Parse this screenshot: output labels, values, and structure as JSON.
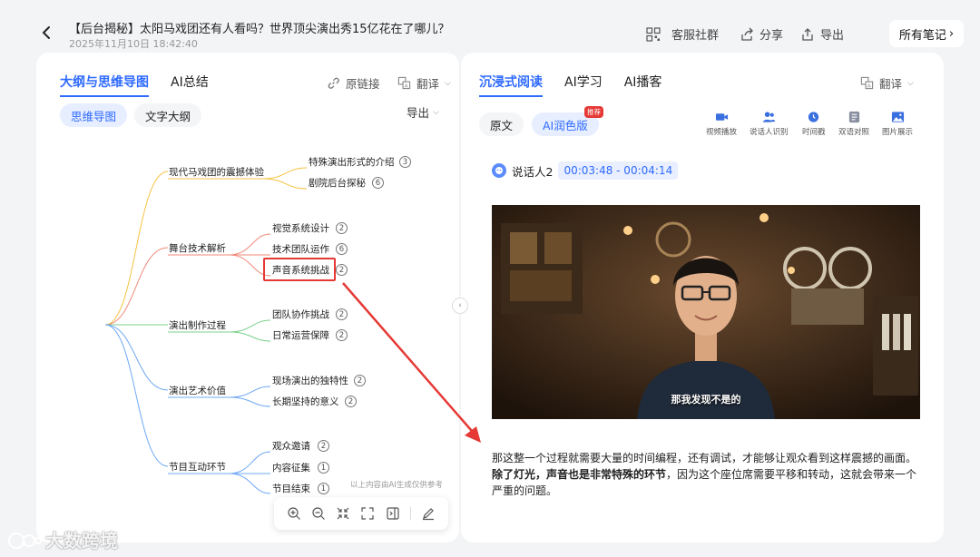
{
  "header": {
    "title": "【后台揭秘】太阳马戏团还有人看吗？世界顶尖演出秀15亿花在了哪儿？",
    "datetime": "2025年11月10日 18:42:40",
    "actions": {
      "community": "客服社群",
      "share": "分享",
      "export": "导出"
    },
    "all_notes": "所有笔记"
  },
  "left_panel": {
    "tabs": [
      {
        "label": "大纲与思维导图",
        "active": true
      },
      {
        "label": "AI总结",
        "active": false
      }
    ],
    "original_link": "原链接",
    "translate": "翻译",
    "view_pills": {
      "mindmap": "思维导图",
      "outline": "文字大纲"
    },
    "export": "导出",
    "mindmap": {
      "branches": [
        {
          "label": "现代马戏团的震撼体验",
          "color": "#f5c242",
          "children": [
            {
              "label": "特殊演出形式的介绍",
              "count": "3"
            },
            {
              "label": "剧院后台探秘",
              "count": "6"
            }
          ]
        },
        {
          "label": "舞台技术解析",
          "color": "#f08a7a",
          "children": [
            {
              "label": "视觉系统设计",
              "count": "2"
            },
            {
              "label": "技术团队运作",
              "count": "6"
            },
            {
              "label": "声音系统挑战",
              "count": "2"
            }
          ]
        },
        {
          "label": "演出制作过程",
          "color": "#7cd18b",
          "children": [
            {
              "label": "团队协作挑战",
              "count": "2"
            },
            {
              "label": "日常运营保障",
              "count": "2"
            }
          ]
        },
        {
          "label": "演出艺术价值",
          "color": "#6fa8f5",
          "children": [
            {
              "label": "现场演出的独特性",
              "count": "2"
            },
            {
              "label": "长期坚持的意义",
              "count": "2"
            }
          ]
        },
        {
          "label": "节目互动环节",
          "color": "#6fa8f5",
          "children": [
            {
              "label": "观众邀请",
              "count": "2"
            },
            {
              "label": "内容征集",
              "count": "1"
            },
            {
              "label": "节目结束",
              "count": "1"
            }
          ]
        }
      ]
    },
    "disclaimer": "以上内容由AI生成仅供参考"
  },
  "right_panel": {
    "tabs": [
      {
        "label": "沉浸式阅读",
        "active": true
      },
      {
        "label": "AI学习",
        "active": false
      },
      {
        "label": "AI播客",
        "active": false
      }
    ],
    "translate": "翻译",
    "version_pills": {
      "original": "原文",
      "polished": "AI润色版"
    },
    "hot_badge": "推荐",
    "tools": [
      {
        "label": "视频播放",
        "icon": "video-camera-icon"
      },
      {
        "label": "说话人识别",
        "icon": "speaker-id-icon"
      },
      {
        "label": "时间戳",
        "icon": "clock-icon"
      },
      {
        "label": "双语对照",
        "icon": "bilingual-icon"
      },
      {
        "label": "图片展示",
        "icon": "image-icon"
      }
    ],
    "speaker": "说话人2",
    "timestamp": "00:03:48 - 00:04:14",
    "video_caption": "那我发现不是的",
    "transcript": {
      "p1": "那这整一个过程就需要大量的时间编程，还有调试，才能够让观众看到这样震撼的画面。",
      "p2_bold": "除了灯光，声音也是非常特殊的环节",
      "p3": "，因为这个座位席需要平移和转动，这就会带来一个严重的问题。"
    }
  },
  "watermark": "大数跨境",
  "colors": {
    "accent": "#2f6bff",
    "highlight": "#e53935"
  }
}
